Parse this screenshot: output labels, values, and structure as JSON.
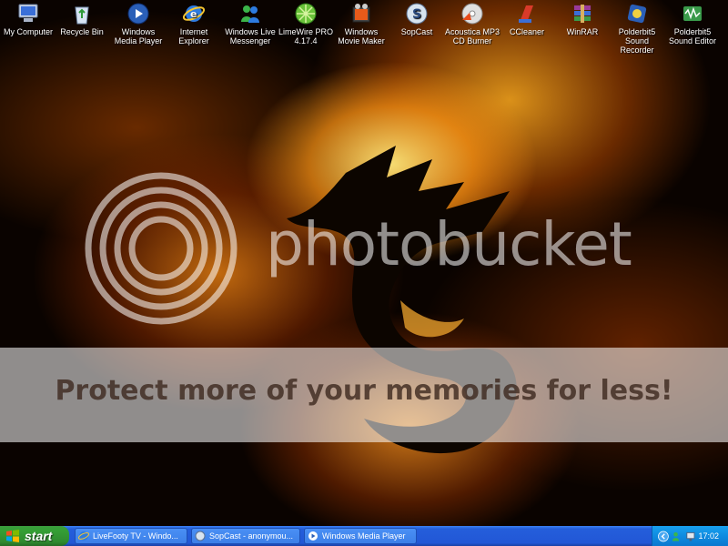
{
  "desktop": {
    "icons": [
      {
        "label": "My Computer"
      },
      {
        "label": "Recycle Bin"
      },
      {
        "label": "Windows Media Player"
      },
      {
        "label": "Internet Explorer"
      },
      {
        "label": "Windows Live Messenger"
      },
      {
        "label": "LimeWire PRO 4.17.4"
      },
      {
        "label": "Windows Movie Maker"
      },
      {
        "label": "SopCast"
      },
      {
        "label": "Acoustica MP3 CD Burner"
      },
      {
        "label": "CCleaner"
      },
      {
        "label": "WinRAR"
      },
      {
        "label": "Polderbit5 Sound Recorder"
      },
      {
        "label": "Polderbit5 Sound Editor"
      }
    ]
  },
  "watermark": {
    "brand": "photobucket",
    "slogan": "Protect more of your memories for less!"
  },
  "taskbar": {
    "start_label": "start",
    "tasks": [
      {
        "label": "LiveFooty TV - Windo..."
      },
      {
        "label": "SopCast - anonymou..."
      },
      {
        "label": "Windows Media Player"
      }
    ],
    "clock": "17:02"
  },
  "colors": {
    "taskbar_blue": "#245edb",
    "start_green": "#35a035",
    "tray_blue": "#0f8be0",
    "flame": "#ff9a1a"
  }
}
